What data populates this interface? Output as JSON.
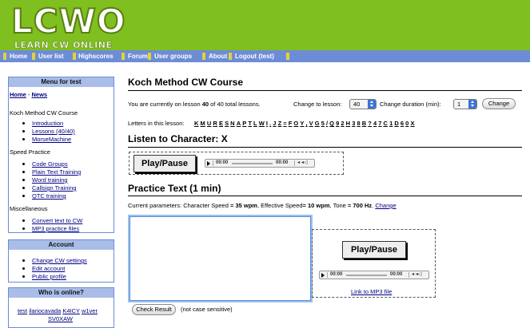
{
  "header": {
    "logo": "LCWO",
    "tagline": "LEARN CW ONLINE",
    "nav": [
      "Home",
      "User list",
      "Highscores",
      "Forum",
      "User groups",
      "About",
      "Logout (test)"
    ]
  },
  "sidebar": {
    "menu_title": "Menu for test",
    "home": "Home",
    "home_sep": " - ",
    "news": "News",
    "koch_heading": "Koch Method CW Course",
    "koch_items": [
      "Introduction",
      "Lessons (40/40)",
      "MorseMachine"
    ],
    "speed_heading": "Speed Practice",
    "speed_items": [
      "Code Groups",
      "Plain Text Training",
      "Word training",
      "Callsign Training",
      "QTC training"
    ],
    "misc_heading": "Miscellaneous",
    "misc_items": [
      "Convert text to CW",
      "MP3 practice files"
    ],
    "account_title": "Account",
    "account_items": [
      "Change CW settings",
      "Edit account",
      "Public profile"
    ],
    "online_title": "Who is online?",
    "online_users_line1": [
      "test",
      "ilariocavada",
      "K4ICY",
      "w1ver"
    ],
    "online_users_line2": [
      "SV0XAW"
    ]
  },
  "main": {
    "title": "Koch Method CW Course",
    "lesson_prefix": "You are currently on lesson ",
    "lesson_current": "40",
    "lesson_mid": " of 40 total lessons.",
    "change_lesson_label": "Change to lesson:",
    "lesson_select_value": "40",
    "change_duration_label": "Change duration (min):",
    "duration_select_value": "1",
    "change_button": "Change",
    "letters_label": "Letters in this lesson:",
    "letters": [
      "K",
      "M",
      "U",
      "R",
      "E",
      "S",
      "N",
      "A",
      "P",
      "T",
      "L",
      "W",
      "I",
      ".",
      "J",
      "Z",
      "=",
      "F",
      "O",
      "Y",
      ",",
      "V",
      "G",
      "5",
      "/",
      "Q",
      "9",
      "2",
      "H",
      "3",
      "8",
      "B",
      "?",
      "4",
      "7",
      "C",
      "1",
      "D",
      "6",
      "0",
      "X"
    ],
    "listen_heading": "Listen to Character: X",
    "play_pause": "Play/Pause",
    "player_time_start": "00:00",
    "player_time_end": "00:00",
    "practice_heading": "Practice Text (1 min)",
    "params_prefix": "Current parameters: Character Speed ",
    "char_speed": "= 35 wpm",
    "params_mid1": ", Effective Speed",
    "eff_speed": "= 10 wpm",
    "params_mid2": ", Tone ",
    "tone": "= 700 Hz",
    "params_end": ".",
    "params_change_link": "Change",
    "textarea_value": "",
    "mp3_link": "Link to MP3 file",
    "check_result_button": "Check Result",
    "case_note": "(not case sensitive)"
  },
  "colors": {
    "header_green": "#7fbf1f",
    "nav_blue": "#6e8cd6",
    "nav_separator_yellow": "#e3d23a",
    "sidebar_head": "#a9bde8",
    "link": "#000080"
  }
}
